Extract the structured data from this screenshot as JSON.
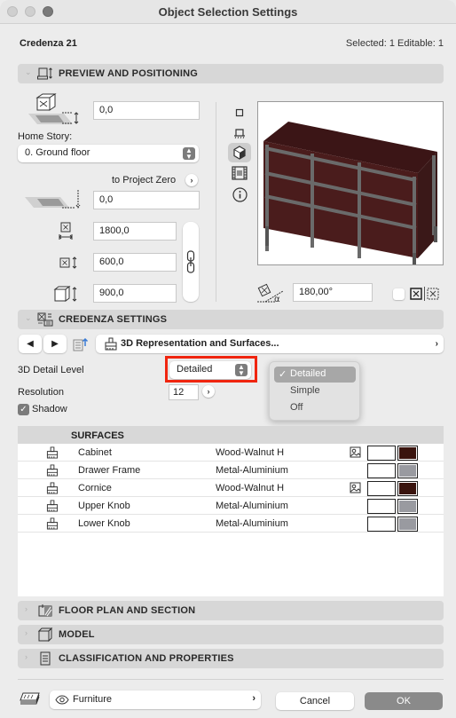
{
  "window": {
    "title": "Object Selection Settings"
  },
  "header": {
    "object_name": "Credenza 21",
    "selection_info": "Selected: 1 Editable: 1"
  },
  "sections": {
    "preview": "PREVIEW AND POSITIONING",
    "credenza": "CREDENZA SETTINGS",
    "floor_plan": "FLOOR PLAN AND SECTION",
    "model": "MODEL",
    "classification": "CLASSIFICATION AND PROPERTIES"
  },
  "positioning": {
    "elevation_to_story": "0,0",
    "home_story_label": "Home Story:",
    "home_story_value": "0. Ground floor",
    "reference_label": "to Project Zero",
    "elevation_to_reference": "0,0",
    "width": "1800,0",
    "depth": "600,0",
    "height": "900,0",
    "rotation_angle": "180,00°"
  },
  "settings": {
    "page_popup": "3D Representation and Surfaces...",
    "detail_level_label": "3D Detail Level",
    "detail_level_value": "Detailed",
    "detail_level_options": [
      "Detailed",
      "Simple",
      "Off"
    ],
    "resolution_label": "Resolution",
    "resolution_value": "12",
    "shadow_label": "Shadow",
    "shadow_checked": true
  },
  "surfaces": {
    "header": "SURFACES",
    "rows": [
      {
        "name": "Cabinet",
        "material": "Wood-Walnut H",
        "has_texture": true,
        "color": "#3a140e"
      },
      {
        "name": "Drawer Frame",
        "material": "Metal-Aluminium",
        "has_texture": false,
        "color": "#999aa0"
      },
      {
        "name": "Cornice",
        "material": "Wood-Walnut H",
        "has_texture": true,
        "color": "#3a140e"
      },
      {
        "name": "Upper Knob",
        "material": "Metal-Aluminium",
        "has_texture": false,
        "color": "#999aa0"
      },
      {
        "name": "Lower Knob",
        "material": "Metal-Aluminium",
        "has_texture": false,
        "color": "#999aa0"
      }
    ]
  },
  "footer": {
    "layer": "Furniture",
    "cancel_label": "Cancel",
    "ok_label": "OK"
  },
  "colors": {
    "highlight": "#f0250f",
    "ok_button": "#8a8a8a"
  }
}
